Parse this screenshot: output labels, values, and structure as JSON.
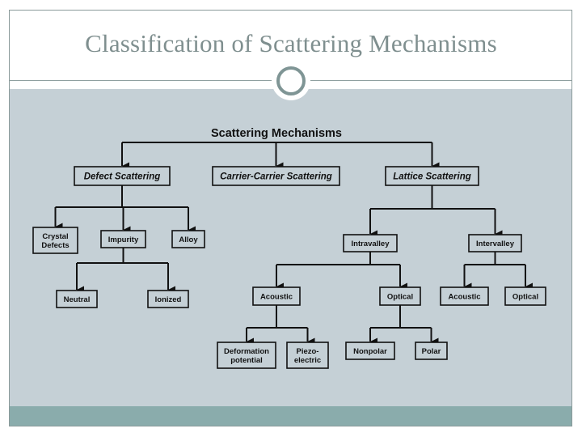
{
  "slide": {
    "title": "Classification of Scattering Mechanisms"
  },
  "diagram": {
    "root": "Scattering Mechanisms",
    "nodes": {
      "defect": {
        "label": [
          "Defect  Scattering"
        ],
        "italic": true
      },
      "carrier": {
        "label": [
          "Carrier-Carrier Scattering"
        ],
        "italic": true
      },
      "lattice": {
        "label": [
          "Lattice Scattering"
        ],
        "italic": true
      },
      "crystal": {
        "label": [
          "Crystal",
          "Defects"
        ]
      },
      "impurity": {
        "label": [
          "Impurity"
        ]
      },
      "alloy": {
        "label": [
          "Alloy"
        ]
      },
      "neutral": {
        "label": [
          "Neutral"
        ]
      },
      "ionized": {
        "label": [
          "Ionized"
        ]
      },
      "intravalley": {
        "label": [
          "Intravalley"
        ]
      },
      "intervalley": {
        "label": [
          "Intervalley"
        ]
      },
      "intra_acoustic": {
        "label": [
          "Acoustic"
        ]
      },
      "intra_optical": {
        "label": [
          "Optical"
        ]
      },
      "inter_acoustic": {
        "label": [
          "Acoustic"
        ]
      },
      "inter_optical": {
        "label": [
          "Optical"
        ]
      },
      "deformation": {
        "label": [
          "Deformation",
          "potential"
        ]
      },
      "piezo": {
        "label": [
          "Piezo-",
          "electric"
        ]
      },
      "nonpolar": {
        "label": [
          "Nonpolar"
        ]
      },
      "polar": {
        "label": [
          "Polar"
        ]
      }
    },
    "edges": [
      [
        "root",
        "defect"
      ],
      [
        "root",
        "carrier"
      ],
      [
        "root",
        "lattice"
      ],
      [
        "defect",
        "crystal"
      ],
      [
        "defect",
        "impurity"
      ],
      [
        "defect",
        "alloy"
      ],
      [
        "impurity",
        "neutral"
      ],
      [
        "impurity",
        "ionized"
      ],
      [
        "lattice",
        "intravalley"
      ],
      [
        "lattice",
        "intervalley"
      ],
      [
        "intravalley",
        "intra_acoustic"
      ],
      [
        "intravalley",
        "intra_optical"
      ],
      [
        "intervalley",
        "inter_acoustic"
      ],
      [
        "intervalley",
        "inter_optical"
      ],
      [
        "intra_acoustic",
        "deformation"
      ],
      [
        "intra_acoustic",
        "piezo"
      ],
      [
        "intra_optical",
        "nonpolar"
      ],
      [
        "intra_optical",
        "polar"
      ]
    ]
  },
  "colors": {
    "panel": "#c5d0d6",
    "footer": "#8aacac",
    "title": "#7f8f8f",
    "node_fill": "#c5d0d6",
    "line": "#111111"
  }
}
